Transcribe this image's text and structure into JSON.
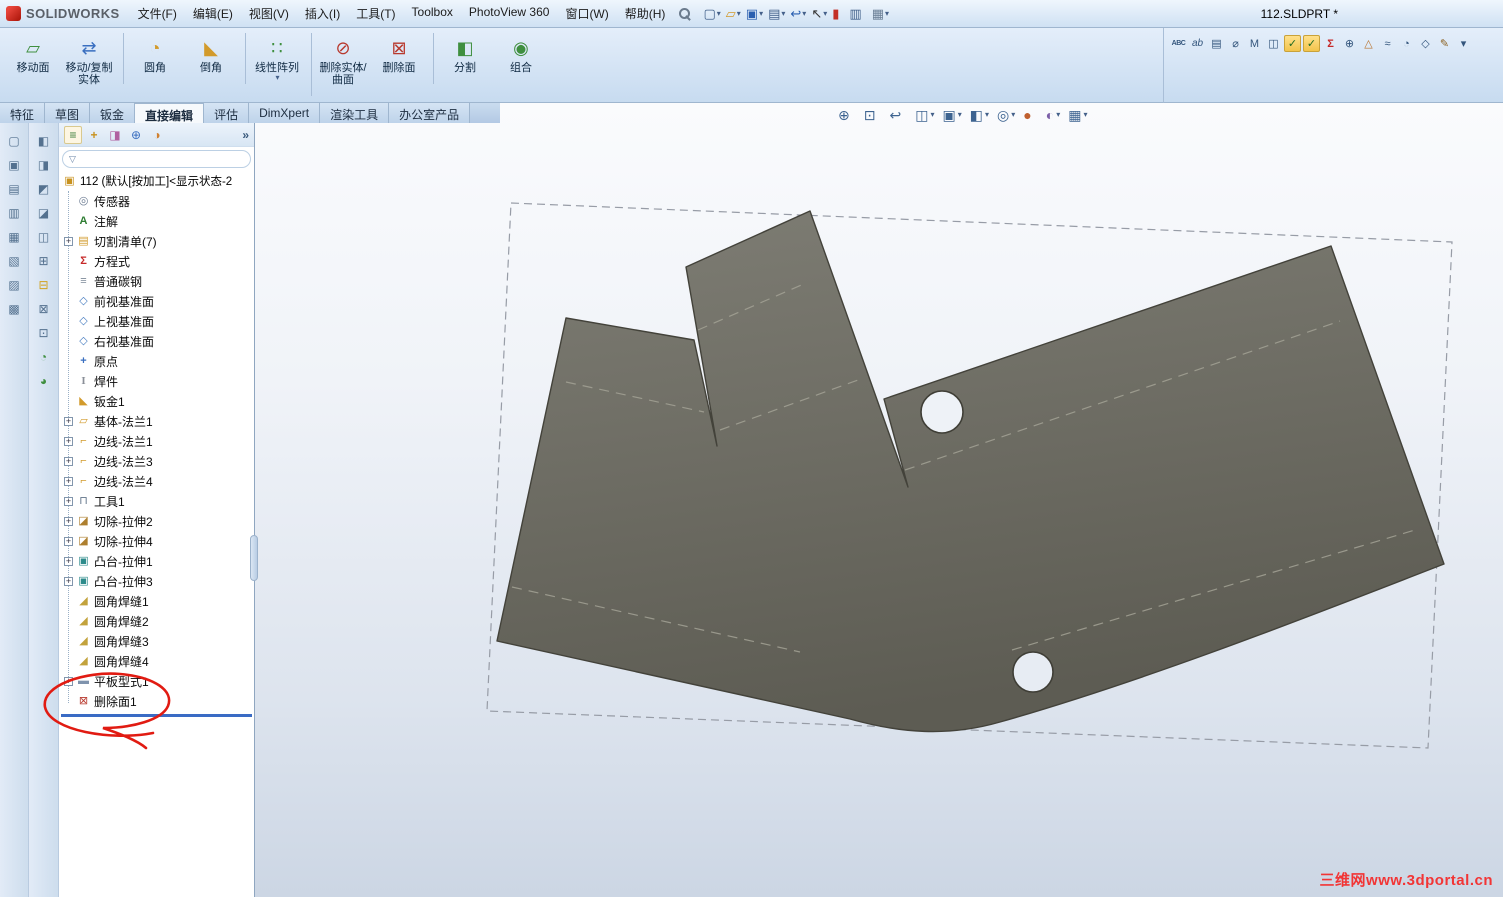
{
  "window": {
    "brand": "SOLIDWORKS",
    "title": "112.SLDPRT *"
  },
  "glyphs": {
    "dropdown": "▾",
    "chevron": "»",
    "funnel": "▽",
    "plus": "+"
  },
  "menubar": {
    "items": [
      "文件(F)",
      "编辑(E)",
      "视图(V)",
      "插入(I)",
      "工具(T)",
      "Toolbox",
      "PhotoView 360",
      "窗口(W)",
      "帮助(H)"
    ]
  },
  "quickbar": {
    "icons": [
      {
        "name": "new-document-icon",
        "glyph": "▢",
        "dropdown": true
      },
      {
        "name": "open-icon",
        "glyph": "▱",
        "dropdown": true
      },
      {
        "name": "save-icon",
        "glyph": "▣",
        "dropdown": true
      },
      {
        "name": "print-icon",
        "glyph": "▤",
        "dropdown": true
      },
      {
        "name": "undo-icon",
        "glyph": "↩",
        "dropdown": true
      },
      {
        "name": "select-icon",
        "glyph": "↖",
        "dropdown": true
      },
      {
        "name": "rebuild-icon",
        "glyph": "▮",
        "dropdown": false
      },
      {
        "name": "file-properties-icon",
        "glyph": "▥",
        "dropdown": false
      },
      {
        "name": "options-icon",
        "glyph": "▦",
        "dropdown": true
      }
    ]
  },
  "direct_edit_toolbar": {
    "buttons": [
      {
        "label": "移动面",
        "icon": "move-face-icon",
        "glyph": "▱"
      },
      {
        "label": "移动/复制实体",
        "icon": "move-copy-body-icon",
        "glyph": "⇄"
      },
      {
        "label": "圆角",
        "icon": "fillet-icon",
        "glyph": "◔",
        "variant": "sep-before"
      },
      {
        "label": "倒角",
        "icon": "chamfer-icon",
        "glyph": "◣"
      },
      {
        "label": "线性阵列",
        "icon": "linear-pattern-icon",
        "glyph": "∷",
        "variant": "sep-before",
        "dropdown": true
      },
      {
        "label": "删除实体/曲面",
        "icon": "delete-body-icon",
        "glyph": "⊘",
        "variant": "sep-before"
      },
      {
        "label": "删除面",
        "icon": "delete-face-icon",
        "glyph": "⊠"
      },
      {
        "label": "分割",
        "icon": "split-icon",
        "glyph": "◧",
        "variant": "sep-before"
      },
      {
        "label": "组合",
        "icon": "combine-icon",
        "glyph": "◉"
      }
    ]
  },
  "tabs": {
    "items": [
      {
        "label": "特征"
      },
      {
        "label": "草图"
      },
      {
        "label": "钣金"
      },
      {
        "label": "直接编辑",
        "variant": "active"
      },
      {
        "label": "评估"
      },
      {
        "label": "DimXpert"
      },
      {
        "label": "渲染工具"
      },
      {
        "label": "办公室产品"
      }
    ]
  },
  "headsup": {
    "icons": [
      {
        "name": "zoom-fit-icon",
        "glyph": "⊕"
      },
      {
        "name": "zoom-area-icon",
        "glyph": "⊡"
      },
      {
        "name": "previous-view-icon",
        "glyph": "↩"
      },
      {
        "name": "section-view-icon",
        "glyph": "◫",
        "dropdown": true
      },
      {
        "name": "view-orientation-icon",
        "glyph": "▣",
        "dropdown": true
      },
      {
        "name": "display-style-icon",
        "glyph": "◧",
        "dropdown": true
      },
      {
        "name": "hide-show-items-icon",
        "glyph": "◎",
        "dropdown": true
      },
      {
        "name": "edit-appearance-icon",
        "glyph": "●"
      },
      {
        "name": "apply-scene-icon",
        "glyph": "◐",
        "dropdown": true
      },
      {
        "name": "view-settings-icon",
        "glyph": "▦",
        "dropdown": true
      }
    ]
  },
  "right_toolbar": {
    "icons": [
      {
        "name": "spell-check-icon",
        "glyph": "ABC"
      },
      {
        "name": "find-replace-icon",
        "glyph": "ab"
      },
      {
        "name": "design-binder-icon",
        "glyph": "▤"
      },
      {
        "name": "measure-icon",
        "glyph": "⌀"
      },
      {
        "name": "mass-properties-icon",
        "glyph": "M"
      },
      {
        "name": "section-properties-icon",
        "glyph": "◫"
      },
      {
        "name": "check-icon",
        "glyph": "✓",
        "variant": "hl"
      },
      {
        "name": "geometry-check-icon",
        "glyph": "✓",
        "variant": "hl"
      },
      {
        "name": "equations-icon",
        "glyph": "Σ"
      },
      {
        "name": "import-diagnostics-icon",
        "glyph": "⊕"
      },
      {
        "name": "deviation-analysis-icon",
        "glyph": "△"
      },
      {
        "name": "zebra-stripes-icon",
        "glyph": "≈"
      },
      {
        "name": "curvature-icon",
        "glyph": "◔"
      },
      {
        "name": "symmetry-check-icon",
        "glyph": "◇"
      },
      {
        "name": "edit-icon",
        "glyph": "✎"
      },
      {
        "name": "more-tools-icon",
        "glyph": "▾"
      }
    ]
  },
  "left_toolbar_outer": {
    "icons": [
      {
        "name": "left-toolbar-icon",
        "glyph": "▢"
      },
      {
        "name": "left-toolbar-icon",
        "glyph": "▣"
      },
      {
        "name": "left-toolbar-icon",
        "glyph": "▤"
      },
      {
        "name": "left-toolbar-icon",
        "glyph": "▥"
      },
      {
        "name": "left-toolbar-icon",
        "glyph": "▦"
      },
      {
        "name": "left-toolbar-icon",
        "glyph": "▧"
      },
      {
        "name": "left-toolbar-icon",
        "glyph": "▨"
      },
      {
        "name": "left-toolbar-icon",
        "glyph": "▩"
      }
    ]
  },
  "left_toolbar_inner": {
    "icons": [
      {
        "name": "left-toolbar-icon",
        "glyph": "◧"
      },
      {
        "name": "left-toolbar-icon",
        "glyph": "◨"
      },
      {
        "name": "left-toolbar-icon",
        "glyph": "◩"
      },
      {
        "name": "left-toolbar-icon",
        "glyph": "◪"
      },
      {
        "name": "left-toolbar-icon",
        "glyph": "◫"
      },
      {
        "name": "left-toolbar-icon",
        "glyph": "⊞"
      },
      {
        "name": "left-toolbar-icon",
        "glyph": "⊟"
      },
      {
        "name": "left-toolbar-icon",
        "glyph": "⊠"
      },
      {
        "name": "left-toolbar-icon",
        "glyph": "⊡"
      },
      {
        "name": "left-toolbar-icon",
        "glyph": "◔"
      },
      {
        "name": "left-toolbar-icon",
        "glyph": "◕"
      }
    ]
  },
  "feature_panel": {
    "tabs": [
      {
        "name": "featuremanager-tab-icon",
        "glyph": "≡"
      },
      {
        "name": "propertymanager-tab-icon",
        "glyph": "+"
      },
      {
        "name": "configurationmanager-tab-icon",
        "glyph": "◨"
      },
      {
        "name": "dimxpertmanager-tab-icon",
        "glyph": "⊕"
      },
      {
        "name": "displaymanager-tab-icon",
        "glyph": "◑"
      }
    ],
    "filter_value": "",
    "tree": {
      "root": {
        "label": "112 (默认[按加工]<显示状态-2",
        "icon": "part"
      },
      "items": [
        {
          "label": "传感器",
          "icon": "sensor"
        },
        {
          "label": "注解",
          "icon": "annotations"
        },
        {
          "label": "切割清单(7)",
          "icon": "cutlist",
          "plus": true
        },
        {
          "label": "方程式",
          "icon": "equations"
        },
        {
          "label": "普通碳钢",
          "icon": "material"
        },
        {
          "label": "前视基准面",
          "icon": "plane"
        },
        {
          "label": "上视基准面",
          "icon": "plane"
        },
        {
          "label": "右视基准面",
          "icon": "plane"
        },
        {
          "label": "原点",
          "icon": "origin"
        },
        {
          "label": "焊件",
          "icon": "weldment"
        },
        {
          "label": "钣金1",
          "icon": "sheetmetal"
        },
        {
          "label": "基体-法兰1",
          "icon": "baseflange",
          "plus": true
        },
        {
          "label": "边线-法兰1",
          "icon": "edgeflange",
          "plus": true
        },
        {
          "label": "边线-法兰3",
          "icon": "edgeflange",
          "plus": true
        },
        {
          "label": "边线-法兰4",
          "icon": "edgeflange",
          "plus": true
        },
        {
          "label": "工具1",
          "icon": "formtool",
          "plus": true
        },
        {
          "label": "切除-拉伸2",
          "icon": "cutextrude",
          "plus": true
        },
        {
          "label": "切除-拉伸4",
          "icon": "cutextrude",
          "plus": true
        },
        {
          "label": "凸台-拉伸1",
          "icon": "bossextrude",
          "plus": true
        },
        {
          "label": "凸台-拉伸3",
          "icon": "bossextrude",
          "plus": true
        },
        {
          "label": "圆角焊缝1",
          "icon": "filletbead"
        },
        {
          "label": "圆角焊缝2",
          "icon": "filletbead"
        },
        {
          "label": "圆角焊缝3",
          "icon": "filletbead"
        },
        {
          "label": "圆角焊缝4",
          "icon": "filletbead"
        },
        {
          "label": "平板型式1",
          "icon": "flatpattern",
          "plus": true
        },
        {
          "label": "删除面1",
          "icon": "deleteface"
        }
      ]
    }
  },
  "watermark": {
    "text": "三维网www.3dportal.cn",
    "color": "#ff3030"
  },
  "colors": {
    "part_fill": "#6c6b62",
    "viewport_top": "#f8fafc",
    "viewport_bottom": "#ccd6e4",
    "annotation": "#e11b12",
    "rollback_bar": "#3a6bc4"
  }
}
